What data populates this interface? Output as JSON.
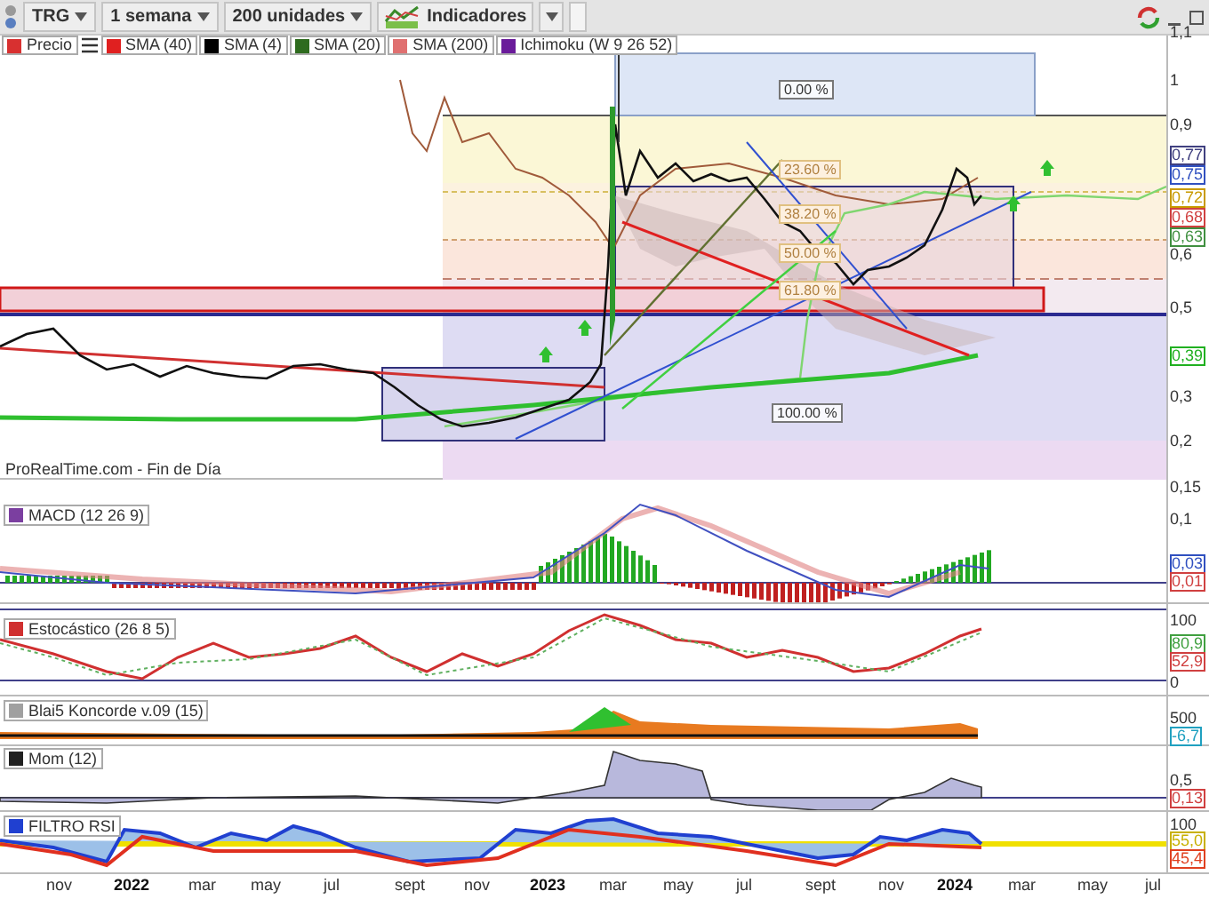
{
  "toolbar": {
    "symbol": "TRG",
    "period": "1 semana",
    "units": "200 unidades",
    "indicators_button": "Indicadores"
  },
  "legend": [
    {
      "label": "Precio",
      "color": "#d83030"
    },
    {
      "label": "SMA (40)",
      "color": "#e02020"
    },
    {
      "label": "SMA (4)",
      "color": "#000000"
    },
    {
      "label": "SMA (20)",
      "color": "#2e6b1e"
    },
    {
      "label": "SMA (200)",
      "color": "#e07070"
    },
    {
      "label": "Ichimoku (W 9 26 52)",
      "color": "#6a1b9a"
    }
  ],
  "main_chart": {
    "fib_levels": [
      "0.00 %",
      "23.60 %",
      "38.20 %",
      "50.00 %",
      "61.80 %",
      "100.00 %"
    ],
    "source": "ProRealTime.com - Fin de Día",
    "axis": [
      {
        "text": "1,1"
      },
      {
        "text": "1"
      },
      {
        "text": "0,9"
      },
      {
        "text": "0,77",
        "color": "#404080"
      },
      {
        "text": "0,75",
        "color": "#3050c0"
      },
      {
        "text": "0,72",
        "color": "#c89a00"
      },
      {
        "text": "0,68",
        "color": "#d04040"
      },
      {
        "text": "0,63",
        "color": "#409040"
      },
      {
        "text": "0,6"
      },
      {
        "text": "0,5"
      },
      {
        "text": "0,39",
        "color": "#20b020"
      },
      {
        "text": "0,3"
      },
      {
        "text": "0,2"
      }
    ]
  },
  "panels": [
    {
      "kind": "macd",
      "label": "MACD (12 26 9)",
      "color": "#7b3fa0",
      "axis": [
        {
          "text": "0,15"
        },
        {
          "text": "0,1"
        },
        {
          "text": "0,03",
          "color": "#3050c0"
        },
        {
          "text": "0,01",
          "color": "#d04040"
        }
      ]
    },
    {
      "kind": "stochastic",
      "label": "Estocástico (26 8 5)",
      "color": "#d03030",
      "axis": [
        {
          "text": "100"
        },
        {
          "text": "80,9",
          "color": "#40a040"
        },
        {
          "text": "52,9",
          "color": "#d04040"
        },
        {
          "text": "0"
        }
      ]
    },
    {
      "kind": "koncorde",
      "label": "Blai5 Koncorde v.09 (15)",
      "color": "#a0a0a0",
      "axis": [
        {
          "text": "500"
        },
        {
          "text": "-6,7",
          "color": "#20a0c0"
        }
      ]
    },
    {
      "kind": "momentum",
      "label": "Mom (12)",
      "color": "#202020",
      "axis": [
        {
          "text": "0,5"
        },
        {
          "text": "0,13",
          "color": "#d04040"
        }
      ]
    },
    {
      "kind": "rsi",
      "label": "FILTRO RSI",
      "color": "#2040d0",
      "axis": [
        {
          "text": "100"
        },
        {
          "text": "55,0",
          "color": "#c8b000"
        },
        {
          "text": "45,4",
          "color": "#e04020"
        }
      ]
    }
  ],
  "x_axis": [
    {
      "text": "nov",
      "year": false
    },
    {
      "text": "2022",
      "year": true
    },
    {
      "text": "mar",
      "year": false
    },
    {
      "text": "may",
      "year": false
    },
    {
      "text": "jul",
      "year": false
    },
    {
      "text": "sept",
      "year": false
    },
    {
      "text": "nov",
      "year": false
    },
    {
      "text": "2023",
      "year": true
    },
    {
      "text": "mar",
      "year": false
    },
    {
      "text": "may",
      "year": false
    },
    {
      "text": "jul",
      "year": false
    },
    {
      "text": "sept",
      "year": false
    },
    {
      "text": "nov",
      "year": false
    },
    {
      "text": "2024",
      "year": true
    },
    {
      "text": "mar",
      "year": false
    },
    {
      "text": "may",
      "year": false
    },
    {
      "text": "jul",
      "year": false
    }
  ]
}
